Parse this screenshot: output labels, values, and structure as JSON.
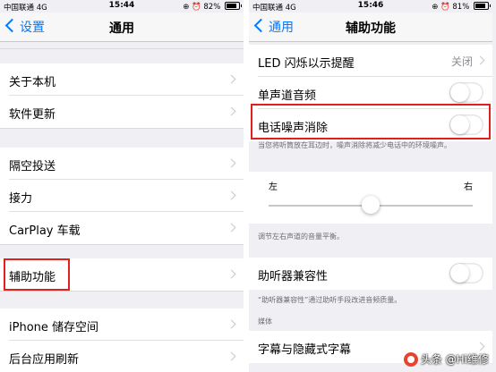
{
  "left": {
    "status": {
      "carrier": "中国联通 4G",
      "time": "15:44",
      "battery": "82%",
      "battery_level": 0.82
    },
    "nav": {
      "back": "设置",
      "title": "通用"
    },
    "items": [
      {
        "label": "关于本机"
      },
      {
        "label": "软件更新"
      },
      {
        "label": "隔空投送"
      },
      {
        "label": "接力"
      },
      {
        "label": "CarPlay 车载"
      },
      {
        "label": "辅助功能"
      },
      {
        "label": "iPhone 储存空间"
      },
      {
        "label": "后台应用刷新"
      }
    ]
  },
  "right": {
    "status": {
      "carrier": "中国联通 4G",
      "time": "15:46",
      "battery": "81%",
      "battery_level": 0.81
    },
    "nav": {
      "back": "通用",
      "title": "辅助功能"
    },
    "led": {
      "label": "LED 闪烁以示提醒",
      "value": "关闭"
    },
    "mono": {
      "label": "单声道音频",
      "on": false
    },
    "noise": {
      "label": "电话噪声消除",
      "on": false
    },
    "noise_note": "当您将听筒放在耳边时，噪声消除将减少电话中的环境噪声。",
    "balance": {
      "left": "左",
      "right": "右",
      "value": 0.5
    },
    "balance_note": "调节左右声道的音量平衡。",
    "hearing": {
      "label": "助听器兼容性",
      "on": false
    },
    "hearing_note": "“助听器兼容性”通过助听手段改进音频质量。",
    "media_header": "媒体",
    "subtitles": {
      "label": "字幕与隐藏式字幕"
    }
  },
  "watermark": "头条 @Hi维修"
}
